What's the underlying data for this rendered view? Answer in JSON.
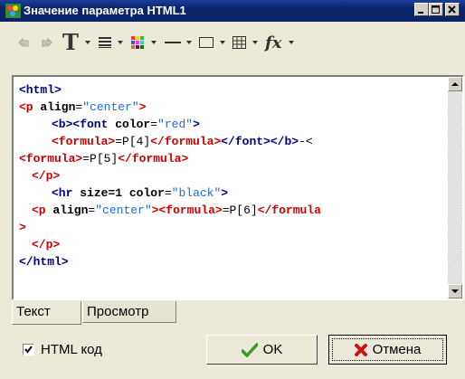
{
  "window": {
    "title": "Значение параметра HTML1",
    "minimize_icon": "minimize-icon",
    "maximize_icon": "maximize-icon",
    "close_icon": "close-icon"
  },
  "toolbar": {
    "items": [
      "undo-icon",
      "redo-icon",
      "font-T-icon",
      "align-icon",
      "color-grid-icon",
      "line-icon",
      "rectangle-icon",
      "table-icon",
      "fx-icon"
    ],
    "fx_label": "fx"
  },
  "editor": {
    "lines": [
      [
        "<html>"
      ],
      [
        "<p ",
        "align",
        "=",
        "\"center\"",
        ">"
      ],
      [
        "<b>",
        "<font ",
        "color",
        "=",
        "\"red\"",
        ">"
      ],
      [
        "<formula>",
        "=P[4]",
        "</formula>",
        "</font>",
        "</b>",
        "-<"
      ],
      [
        "<formula>",
        "=P[5]",
        "</formula>"
      ],
      [
        "</p>"
      ],
      [
        "<hr ",
        "size",
        "=1 ",
        "color",
        "=",
        "\"black\"",
        ">"
      ],
      [
        "<p ",
        "align",
        "=",
        "\"center\"",
        ">",
        "<formula>",
        "=P[6]",
        "</formula"
      ],
      [
        ">"
      ],
      [
        "</p>"
      ],
      [
        "</html>"
      ]
    ]
  },
  "tabs": {
    "text": "Текст",
    "preview": "Просмотр"
  },
  "footer": {
    "html_code_label": "HTML код",
    "html_code_checked": true,
    "ok_label": "OK",
    "cancel_label": "Отмена"
  },
  "colors": {
    "title_bar": "#0a246a",
    "tag_blue": "#000080",
    "tag_red": "#cc0000",
    "value_blue": "#1e6ad6"
  }
}
